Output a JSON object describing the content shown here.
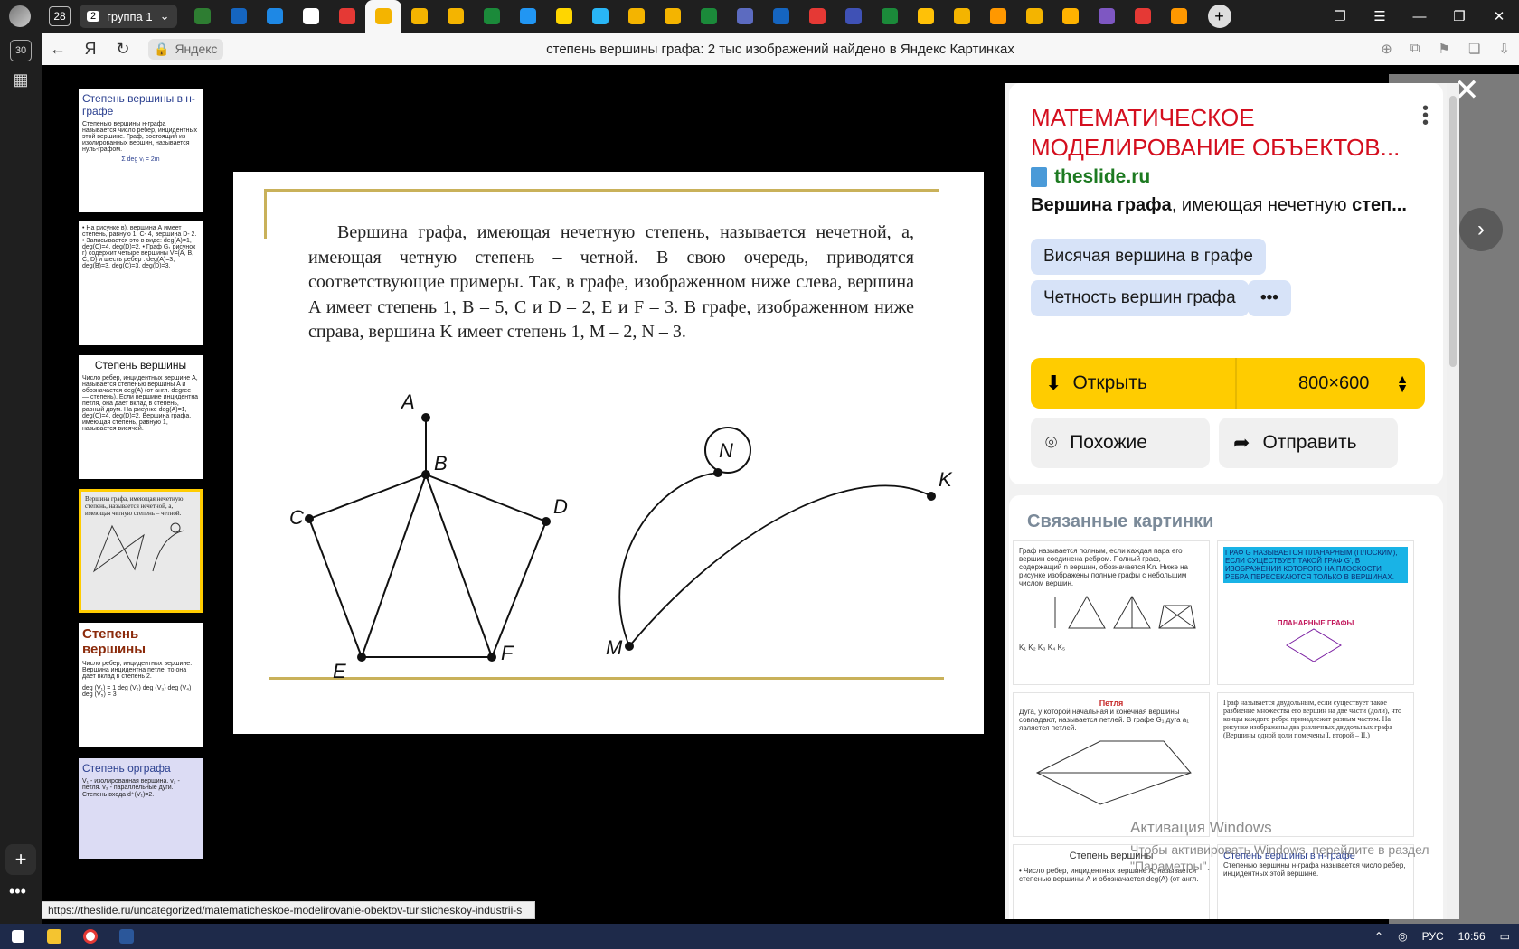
{
  "tabbar": {
    "tab_count": "28",
    "group_number": "2",
    "group_label": "группа 1",
    "tab_colors": [
      "#2e7d32",
      "#1565c0",
      "#1e88e5",
      "#ffffff",
      "#e53935",
      "#f4b400",
      "#f4b400",
      "#f4b400",
      "#1b8a3a",
      "#2196f3",
      "#ffd600",
      "#29b6f6",
      "#f4b400",
      "#f4b400",
      "#1b8a3a",
      "#5c6bc0",
      "#1565c0",
      "#e53935",
      "#3f51b5",
      "#1b8a3a",
      "#ffc107",
      "#f4b400",
      "#ff9800",
      "#f4b400",
      "#ffb300",
      "#7e57c2",
      "#e53935",
      "#ff9800"
    ]
  },
  "rail": {
    "counter": "30"
  },
  "address": {
    "host": "Яндекс",
    "title": "степень вершины графа: 2 тыс изображений найдено в Яндекс Картинках"
  },
  "thumbs": {
    "t1_title": "Степень вершины в н-графе",
    "t1_text": "Степенью вершины н-графа называется число ребер, инцидентных этой вершине. Граф, состоящий из изолированных вершин, называется нуль-графом.",
    "t1_formula": "Σ deg vᵢ = 2m",
    "t2_text": "• На рисунке в), вершина А имеет степень, равную 1, С- 4, вершина D- 2. • Записывается это в виде: deg(A)=1, deg(C)=4, deg(D)=2. • Граф G₁ рисунок г) содержит четыре вершины V={A, B, C, D} и шесть ребер : deg(A)=3, deg(B)=3, deg(C)=3, deg(D)=3.",
    "t3_title": "Степень вершины",
    "t3_text": "Число ребер, инцидентных вершине A, называется степенью вершины A и обозначается deg(A) (от англ. degree — степень). Если вершине инцидентна петля, она дает вклад в степень, равный двум. На рисунке deg(A)=1, deg(C)=4, deg(D)=2. Вершина графа, имеющая степень, равную 1, называется висячей.",
    "t4_text": "Вершина графа, имеющая нечетную степень, называется нечетной, а, имеющая четную степень – четной.",
    "t5_title": "Степень вершины",
    "t5_text": "Число ребер, инцидентных вершине. Вершина инцидентна петле, то она дает вклад в степень 2.",
    "t5_list": "deg (V₁) = 1   deg (V₂)   deg (V₃)   deg (V₄)   deg (V₅) = 3",
    "t6_title": "Степень орграфа",
    "t6_text": "V₁ - изолированная вершина. v₂ - петля. v₃ - параллельные дуги. Степень входа d⁺(V₁)=2."
  },
  "main_image": {
    "text": "Вершина графа, имеющая нечетную степень, называется нечетной, а, имеющая четную степень – четной. В свою очередь, приводятся соответствующие примеры. Так, в графе, изображенном ниже слева, вершина A имеет степень 1, B – 5, C и D – 2, E и F – 3. В графе, изображенном ниже справа, вершина K имеет степень 1, M – 2, N – 3.",
    "labels": {
      "A": "A",
      "B": "B",
      "C": "C",
      "D": "D",
      "E": "E",
      "F": "F",
      "N": "N",
      "K": "K",
      "M": "M"
    }
  },
  "panel": {
    "title": "МАТЕМАТИЧЕСКОЕ МОДЕЛИРОВАНИЕ ОБЪЕКТОВ...",
    "site": "theslide.ru",
    "desc_bold1": "Вершина графа",
    "desc_mid": ", имеющая нечетную ",
    "desc_bold2": "степ...",
    "chip1": "Висячая вершина в графе",
    "chip2": "Четность вершин графа",
    "chip_more": "•••",
    "open_label": "Открыть",
    "size_label": "800×600",
    "similar_label": "Похожие",
    "share_label": "Отправить",
    "related_header": "Связанные картинки"
  },
  "related": {
    "r1_text": "Граф называется полным, если каждая пара его вершин соединена ребром. Полный граф, содержащий n вершин, обозначается Kn. Ниже на рисунке изображены полные графы с небольшим числом вершин.",
    "r1_caption": "K₁  K₂     K₃      K₄      K₅",
    "r2_text": "ГРАФ G НАЗЫВАЕТСЯ ПЛАНАРНЫМ (ПЛОСКИМ), ЕСЛИ СУЩЕСТВУЕТ ТАКОЙ ГРАФ G', В ИЗОБРАЖЕНИИ КОТОРОГО НА ПЛОСКОСТИ РЕБРА ПЕРЕСЕКАЮТСЯ ТОЛЬКО В ВЕРШИНАХ.",
    "r2_label": "ПЛАНАРНЫЕ ГРАФЫ",
    "r3_title": "Петля",
    "r3_text": "Дуга, у которой начальная и конечная вершины совпадают, называется петлей. В графе G₁ дуга a₁ является петлей.",
    "r4_text": "Граф называется двудольным, если существует такое разбиение множества его вершин на две части (доли), что концы каждого ребра принадлежат разным частям. На рисунке изображены два различных двудольных графа (Вершины одной доли помечены I, второй – II.)",
    "r5_title": "Степень вершины",
    "r5_text": "• Число ребер, инцидентных вершине А, называется степенью вершины А и обозначается deg(A) (от англ.",
    "r6_title": "Степень вершины в н-графе",
    "r6_text": "Степенью вершины н-графа называется число ребер, инцидентных этой вершине."
  },
  "activation": {
    "line1": "Активация Windows",
    "line2": "Чтобы активировать Windows, перейдите в раздел",
    "line3": "\"Параметры\"."
  },
  "status_url": "https://theslide.ru/uncategorized/matematicheskoe-modelirovanie-obektov-turisticheskoy-industrii-s",
  "taskbar": {
    "lang": "РУС",
    "time": "10:56"
  }
}
